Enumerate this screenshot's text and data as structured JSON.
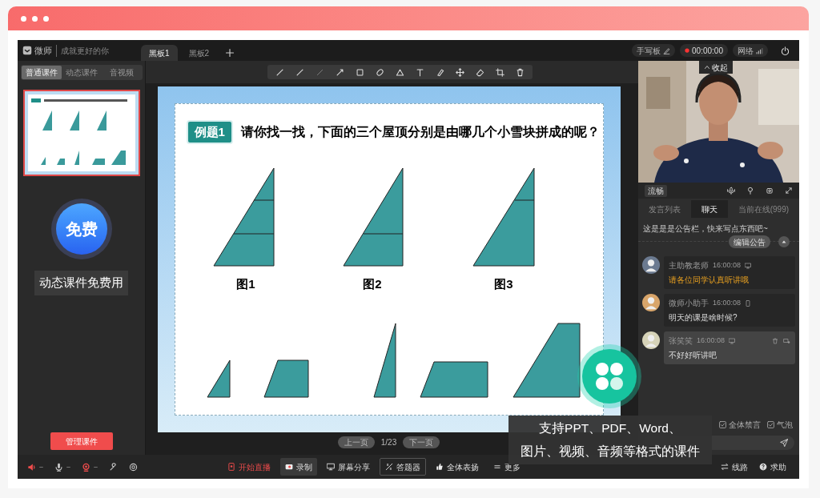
{
  "app": {
    "logo": "微师",
    "slogan": "成就更好的你"
  },
  "board_tabs": [
    {
      "label": "黑板1",
      "selected": true
    },
    {
      "label": "黑板2",
      "selected": false
    }
  ],
  "status": {
    "tablet": "手写板",
    "timer": "00:00:00",
    "network": "网络"
  },
  "courseware_tabs": [
    {
      "label": "普通课件",
      "selected": true
    },
    {
      "label": "动态课件",
      "selected": false
    },
    {
      "label": "音视频",
      "selected": false
    }
  ],
  "promo": {
    "badge": "免费",
    "caption": "动态课件免费用"
  },
  "manage_button": "管理课件",
  "slide": {
    "badge": "例题1",
    "question": "请你找一找，下面的三个屋顶分别是由哪几个小雪块拼成的呢？",
    "figures": [
      "图1",
      "图2",
      "图3"
    ]
  },
  "pager": {
    "prev": "上一页",
    "page": "1/23",
    "next": "下一页"
  },
  "video": {
    "collapse": "收起",
    "quality": "流畅"
  },
  "chat_tabs": [
    {
      "label": "发言列表",
      "selected": false
    },
    {
      "label": "聊天",
      "selected": true
    },
    {
      "label": "当前在线(999)",
      "selected": false
    }
  ],
  "announcement": {
    "text": "这是是是公告栏，快来写点东西吧~",
    "edit_button": "编辑公告"
  },
  "messages": [
    {
      "name": "主助教老师",
      "time": "16:00:08",
      "kind": "desktop",
      "text": "请各位同学认真听讲哦",
      "notice": true,
      "selected": false
    },
    {
      "name": "微师小助手",
      "time": "16:00:08",
      "kind": "phone",
      "text": "明天的课是啥时候?",
      "notice": false,
      "selected": false
    },
    {
      "name": "张笑笑",
      "time": "16:00:08",
      "kind": "desktop",
      "text": "不好好听讲吧",
      "notice": false,
      "selected": true
    }
  ],
  "chat_options": [
    {
      "label": "全体禁言",
      "checked": true
    },
    {
      "label": "气泡",
      "checked": true
    }
  ],
  "actions": [
    {
      "label": "开始直播",
      "kind": "live",
      "selected": false
    },
    {
      "label": "录制",
      "kind": "record",
      "selected": true
    },
    {
      "label": "屏幕分享",
      "kind": "share",
      "selected": false
    },
    {
      "label": "答题器",
      "kind": "quiz",
      "selected": false
    },
    {
      "label": "全体表扬",
      "kind": "praise",
      "selected": false
    },
    {
      "label": "更多",
      "kind": "more",
      "selected": false
    }
  ],
  "right_actions": [
    {
      "label": "线路",
      "kind": "route"
    },
    {
      "label": "求助",
      "kind": "help"
    }
  ],
  "tooltip": {
    "lines": [
      "支持PPT、PDF、Word、",
      "图片、视频、音频等格式的课件"
    ]
  }
}
